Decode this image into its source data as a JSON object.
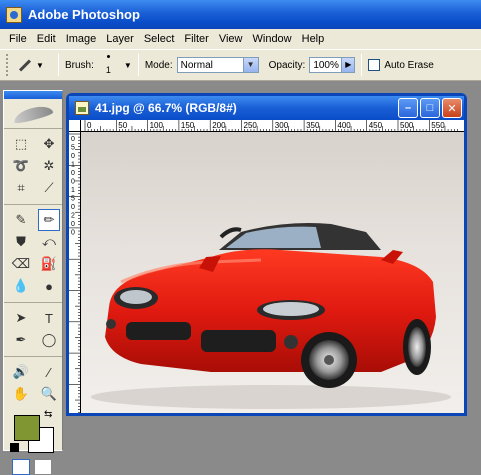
{
  "app": {
    "title": "Adobe Photoshop",
    "accent_color": "#0a4cc8"
  },
  "menu": {
    "items": [
      "File",
      "Edit",
      "Image",
      "Layer",
      "Select",
      "Filter",
      "View",
      "Window",
      "Help"
    ]
  },
  "options": {
    "brush_label": "Brush:",
    "brush_size": "1",
    "mode_label": "Mode:",
    "mode_value": "Normal",
    "opacity_label": "Opacity:",
    "opacity_value": "100%",
    "auto_erase_label": "Auto Erase",
    "auto_erase_checked": false
  },
  "toolbox": {
    "foreground_color": "#7f9632",
    "background_color": "#ffffff",
    "active_tool": "pencil"
  },
  "document": {
    "title": "41.jpg @ 66.7% (RGB/8#)",
    "zoom_percent": 66.7,
    "ruler_h_labels": [
      "0",
      "50",
      "100",
      "150",
      "200",
      "250",
      "300",
      "350",
      "400",
      "450",
      "500",
      "550"
    ],
    "ruler_v_labels": [
      "0",
      "5",
      "0",
      "1",
      "0",
      "0",
      "1",
      "5",
      "0",
      "2",
      "0",
      "0"
    ]
  },
  "image": {
    "subject": "red-sports-car",
    "car_color": "#e01a10"
  }
}
